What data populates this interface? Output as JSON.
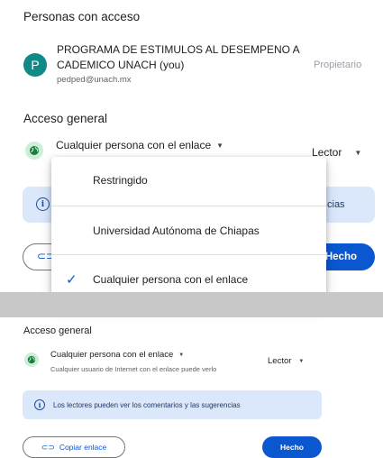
{
  "people_section": {
    "heading": "Personas con acceso",
    "owner": {
      "avatar_letter": "P",
      "name": "PROGRAMA DE ESTIMULOS AL DESEMPENO A CADEMICO UNACH (you)",
      "email": "pedped@unach.mx",
      "role": "Propietario"
    }
  },
  "general_access": {
    "heading": "Acceso general",
    "selected": "Cualquier persona con el enlace",
    "role": "Lector",
    "banner_partial_text": "cias",
    "done_label": "Hecho"
  },
  "dropdown": {
    "options": [
      {
        "label": "Restringido",
        "checked": false
      },
      {
        "label": "Universidad Autónoma de Chiapas",
        "checked": false
      },
      {
        "label": "Cualquier persona con el enlace",
        "checked": true
      }
    ]
  },
  "bottom_dialog": {
    "heading": "Acceso general",
    "selected": "Cualquier persona con el enlace",
    "description": "Cualquier usuario de Internet con el enlace puede verlo",
    "role": "Lector",
    "info_text": "Los lectores pueden ver los comentarios y las sugerencias",
    "copy_link_label": "Copiar enlace",
    "done_label": "Hecho"
  },
  "colors": {
    "accent_blue": "#0b57d0",
    "avatar_teal": "#0f8a86",
    "globe_green": "#188038",
    "info_banner": "#dbe7fb",
    "separator_grey": "#c8c8c8"
  },
  "icons": {
    "avatar": "letter-avatar",
    "globe": "globe-icon",
    "caret": "caret-down-icon",
    "info": "info-icon",
    "link": "link-icon",
    "check": "check-icon"
  }
}
